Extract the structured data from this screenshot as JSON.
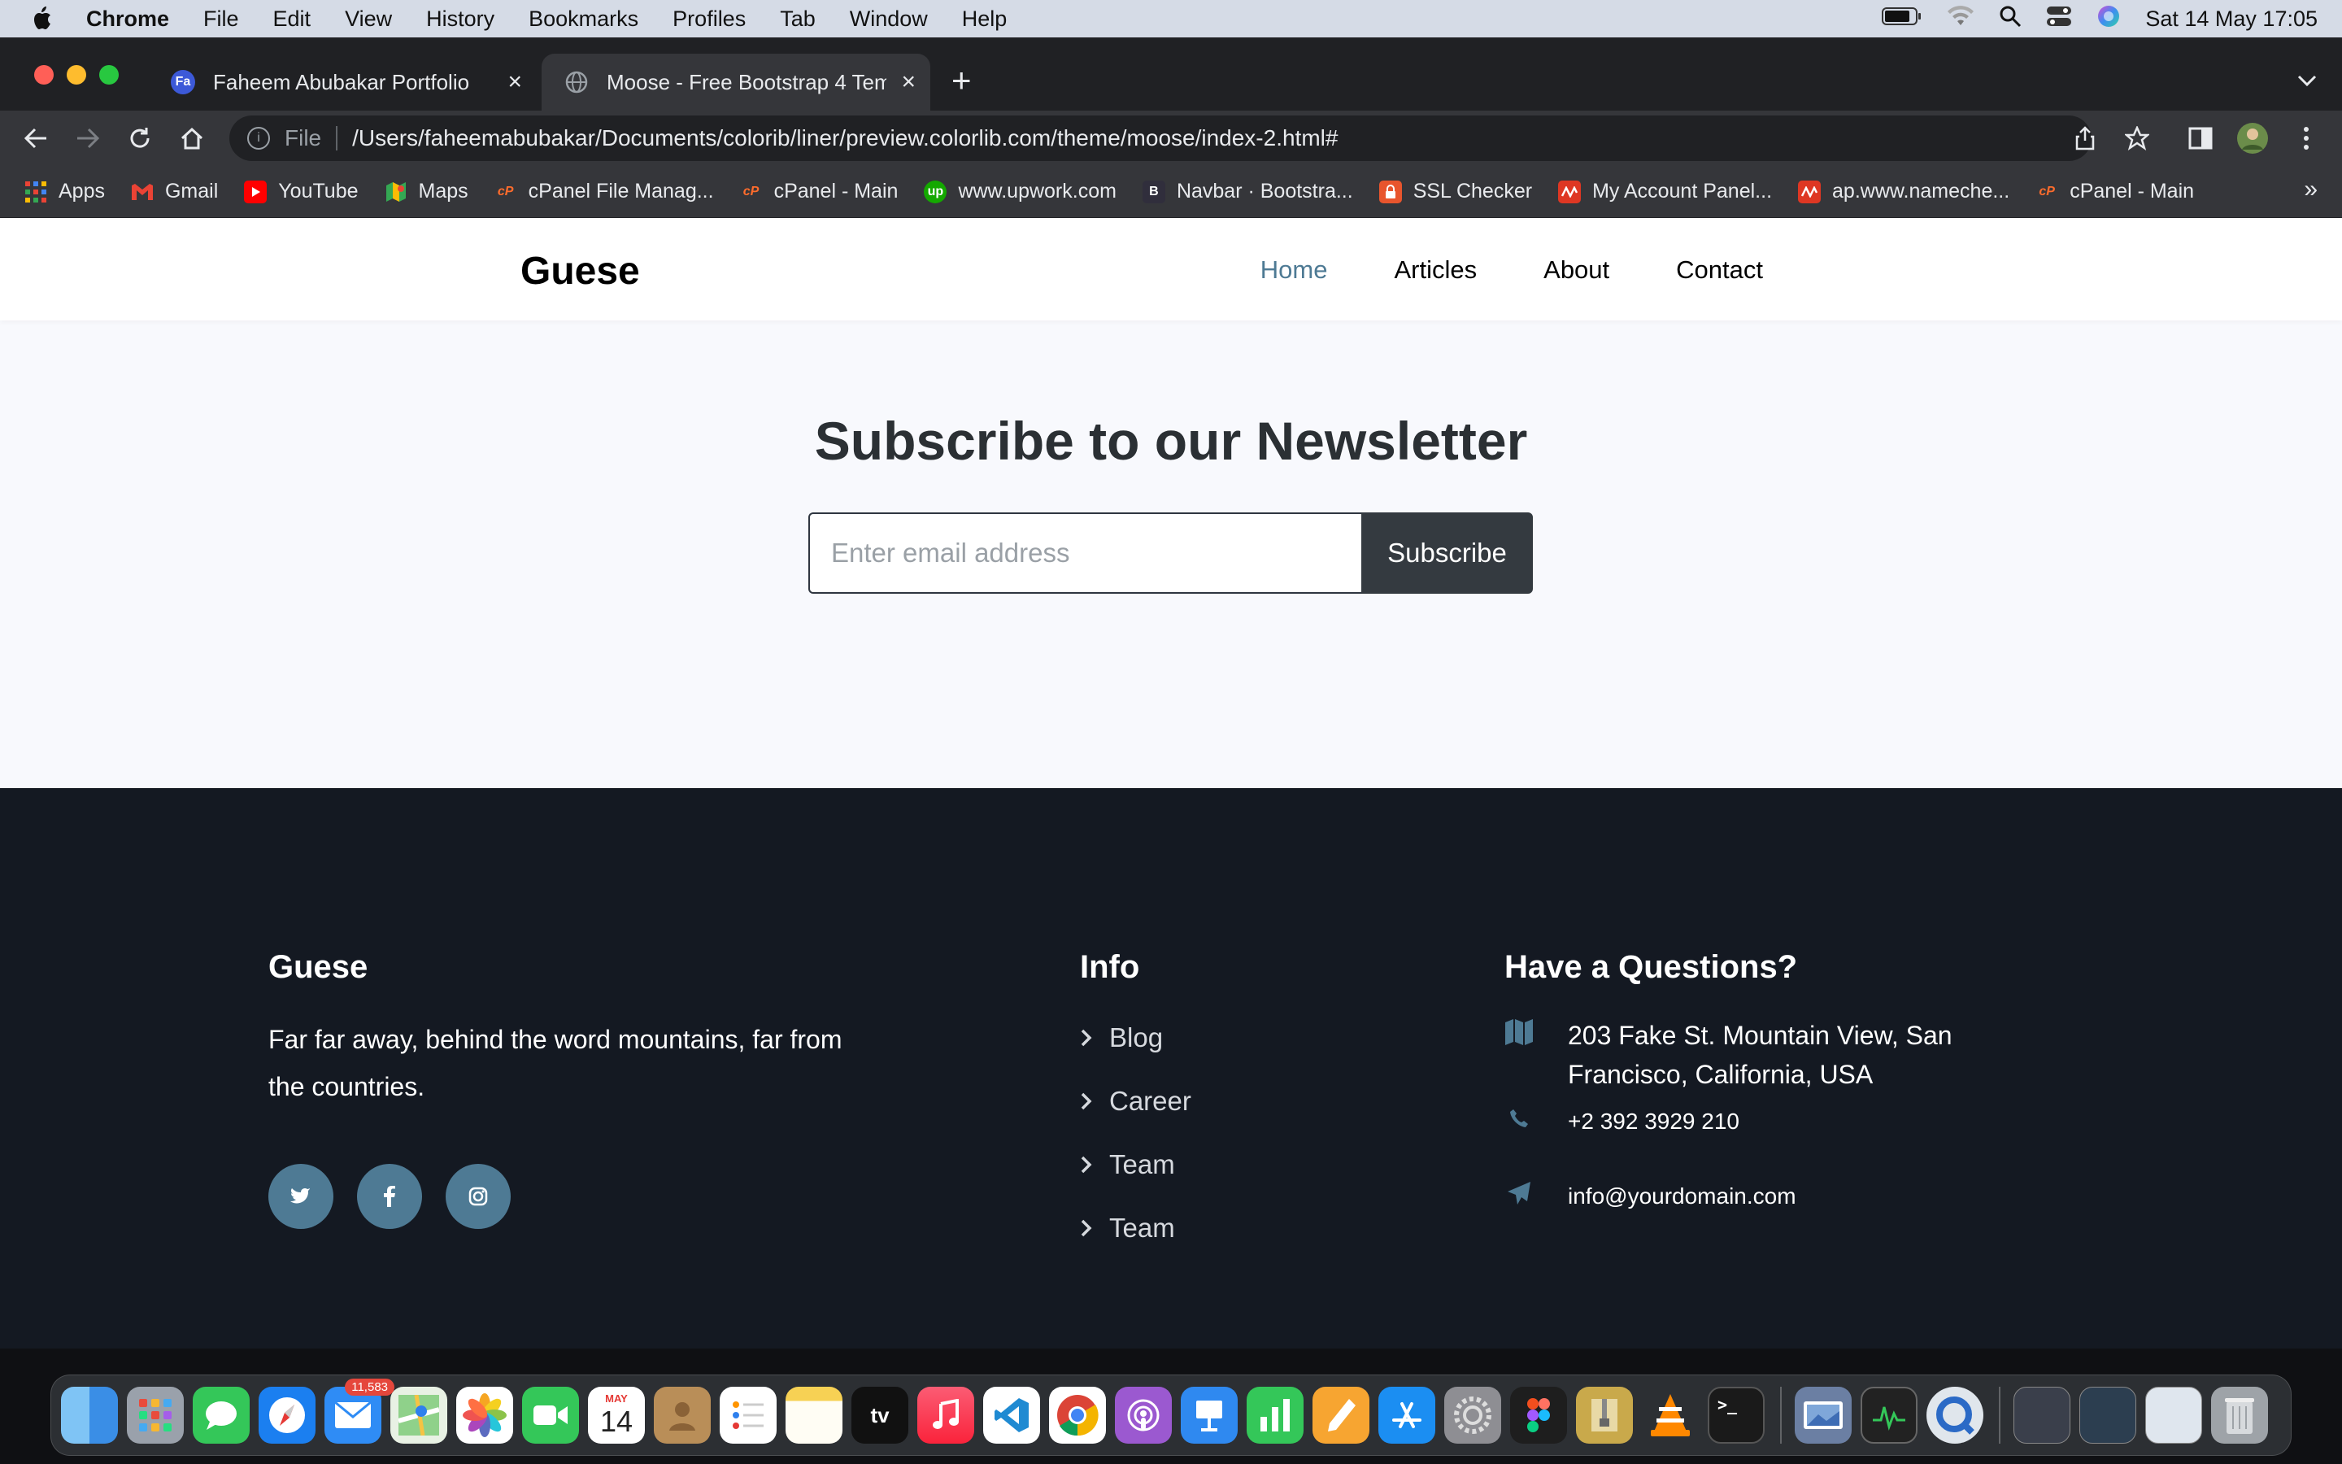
{
  "menubar": {
    "app": "Chrome",
    "items": [
      "File",
      "Edit",
      "View",
      "History",
      "Bookmarks",
      "Profiles",
      "Tab",
      "Window",
      "Help"
    ],
    "clock": "Sat 14 May  17:05"
  },
  "browser": {
    "tabs": [
      {
        "title": "Faheem Abubakar Portfolio",
        "favicon": "Fa",
        "active": false
      },
      {
        "title": "Moose - Free Bootstrap 4 Temp",
        "favicon": "globe",
        "active": true
      }
    ],
    "address": {
      "scheme": "File",
      "url": "/Users/faheemabubakar/Documents/colorib/liner/preview.colorlib.com/theme/moose/index-2.html#"
    },
    "bookmarks": [
      {
        "label": "Apps",
        "icon": "apps-grid-icon",
        "color": "#ea4335"
      },
      {
        "label": "Gmail",
        "icon": "gmail-icon",
        "color": "#ea4335"
      },
      {
        "label": "YouTube",
        "icon": "youtube-icon",
        "color": "#ff0000"
      },
      {
        "label": "Maps",
        "icon": "maps-icon",
        "color": "#34a853"
      },
      {
        "label": "cPanel File Manag...",
        "icon": "cpanel-icon",
        "color": "#ff6c2c"
      },
      {
        "label": "cPanel - Main",
        "icon": "cpanel-icon",
        "color": "#ff6c2c"
      },
      {
        "label": "www.upwork.com",
        "icon": "upwork-icon",
        "color": "#14a800"
      },
      {
        "label": "Navbar · Bootstra...",
        "icon": "bootstrap-icon",
        "color": "#7952b3"
      },
      {
        "label": "SSL Checker",
        "icon": "ssl-icon",
        "color": "#e8552d"
      },
      {
        "label": "My Account Panel...",
        "icon": "namecheap-icon",
        "color": "#de3723"
      },
      {
        "label": "ap.www.nameche...",
        "icon": "namecheap-icon",
        "color": "#de3723"
      },
      {
        "label": "cPanel - Main",
        "icon": "cpanel-icon",
        "color": "#ff6c2c"
      }
    ]
  },
  "site": {
    "brand": "Guese",
    "nav": [
      "Home",
      "Articles",
      "About",
      "Contact"
    ],
    "active_nav": "Home",
    "newsletter": {
      "title": "Subscribe to our Newsletter",
      "placeholder": "Enter email address",
      "button": "Subscribe"
    },
    "footer": {
      "brand": "Guese",
      "description": "Far far away, behind the word mountains, far from the countries.",
      "social": [
        "twitter-icon",
        "facebook-icon",
        "instagram-icon"
      ],
      "info_title": "Info",
      "info_links": [
        "Blog",
        "Career",
        "Team",
        "Team"
      ],
      "contact_title": "Have a Questions?",
      "address": "203 Fake St. Mountain View, San Francisco, California, USA",
      "phone": "+2 392 3929 210",
      "email": "info@yourdomain.com"
    }
  },
  "dock": {
    "mail_badge": "11,583",
    "calendar_month": "MAY",
    "calendar_day": "14",
    "tv_label": "tv"
  },
  "colors": {
    "accent": "#4e7a94",
    "footer_bg": "#141922",
    "page_bg": "#f8f9fd",
    "button_dark": "#343a40"
  }
}
